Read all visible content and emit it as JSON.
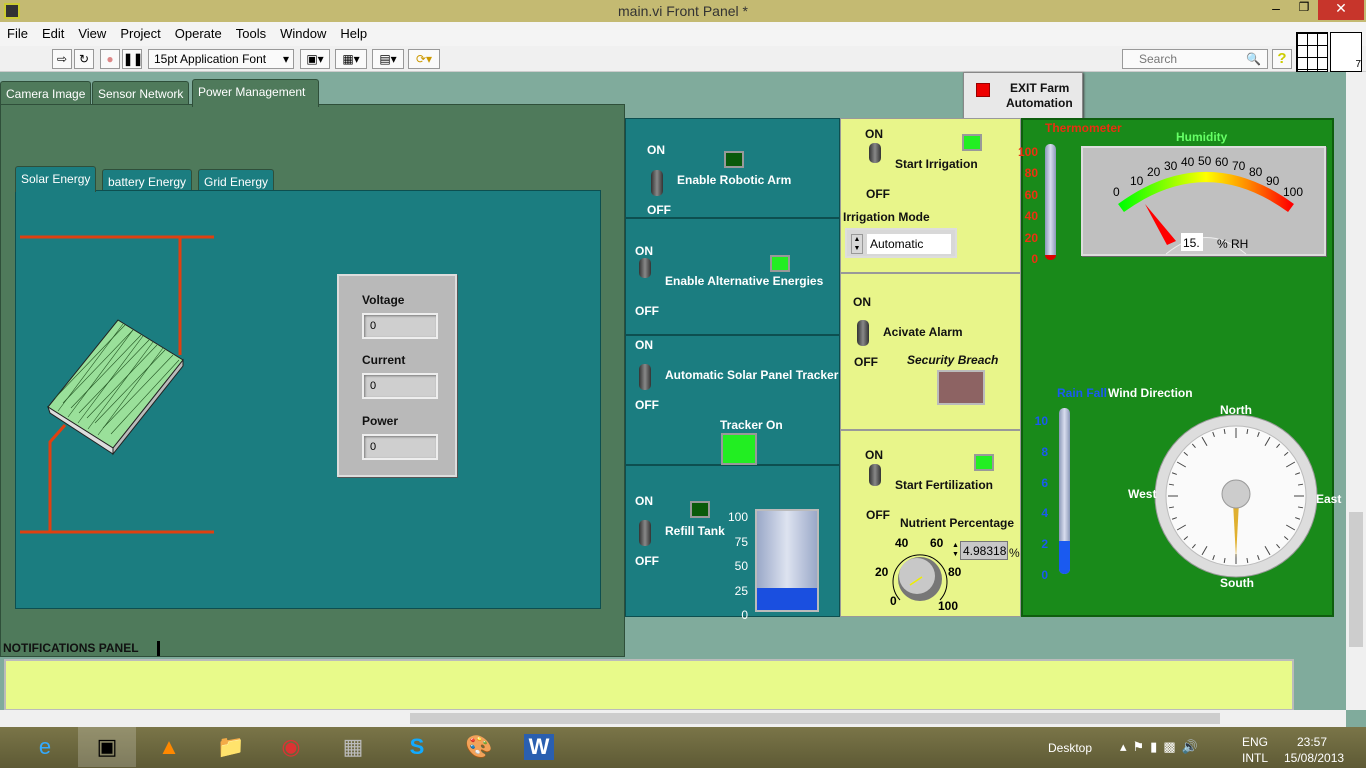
{
  "window": {
    "title": "main.vi Front Panel *"
  },
  "menu": [
    "File",
    "Edit",
    "View",
    "Project",
    "Operate",
    "Tools",
    "Window",
    "Help"
  ],
  "toolbar": {
    "font": "15pt Application Font",
    "search_placeholder": "Search",
    "help": "?"
  },
  "tabs": [
    "Camera Image",
    "Sensor Network",
    "Power Management"
  ],
  "active_tab": "Power Management",
  "subtabs": [
    "Solar Energy",
    "battery Energy",
    "Grid Energy"
  ],
  "readouts": [
    {
      "label": "Voltage",
      "value": "0"
    },
    {
      "label": "Current",
      "value": "0"
    },
    {
      "label": "Power",
      "value": "0"
    }
  ],
  "exit_button": {
    "line1": "EXIT  Farm",
    "line2": "Automation"
  },
  "controls": {
    "on": "ON",
    "off": "OFF",
    "robotic_arm": "Enable Robotic Arm",
    "alt_energy": "Enable Alternative Energies",
    "solar_tracker": "Automatic Solar Panel Tracker",
    "tracker_on": "Tracker On",
    "refill_tank": "Refill Tank",
    "tank_ticks": [
      "100",
      "75",
      "50",
      "25",
      "0"
    ],
    "tank_level_percent": 22,
    "irrigation": "Start Irrigation",
    "irrigation_mode_label": "Irrigation Mode",
    "irrigation_mode": "Automatic",
    "alarm": "Acivate Alarm",
    "security_breach": "Security Breach",
    "fertilization": "Start Fertilization",
    "nutrient_label": "Nutrient Percentage",
    "nutrient_value": "4.98318",
    "nutrient_unit": "%",
    "knob_ticks": [
      "0",
      "20",
      "40",
      "60",
      "80",
      "100"
    ]
  },
  "sensors": {
    "thermometer": "Thermometer",
    "thermo_ticks": [
      "100",
      "80",
      "60",
      "40",
      "20",
      "0"
    ],
    "humidity": "Humidity",
    "humidity_ticks": [
      "0",
      "10",
      "20",
      "30",
      "40",
      "50",
      "60",
      "70",
      "80",
      "90",
      "100"
    ],
    "humidity_value": "15.",
    "humidity_unit": "% RH",
    "rainfall": "Rain Fall",
    "rain_ticks": [
      "10",
      "8",
      "6",
      "4",
      "2",
      "0"
    ],
    "rain_level": 2,
    "wind": "Wind Direction",
    "north": "North",
    "south": "South",
    "east": "East",
    "west": "West"
  },
  "notifications": {
    "label": "NOTIFICATIONS PANEL"
  },
  "taskbar": {
    "desktop": "Desktop",
    "lang1": "ENG",
    "lang2": "INTL",
    "time": "23:57",
    "date": "15/08/2013"
  },
  "colors": {
    "teal": "#1b7d80",
    "yellow": "#e8f58a",
    "green": "#198a1a",
    "wire": "#e04010"
  }
}
